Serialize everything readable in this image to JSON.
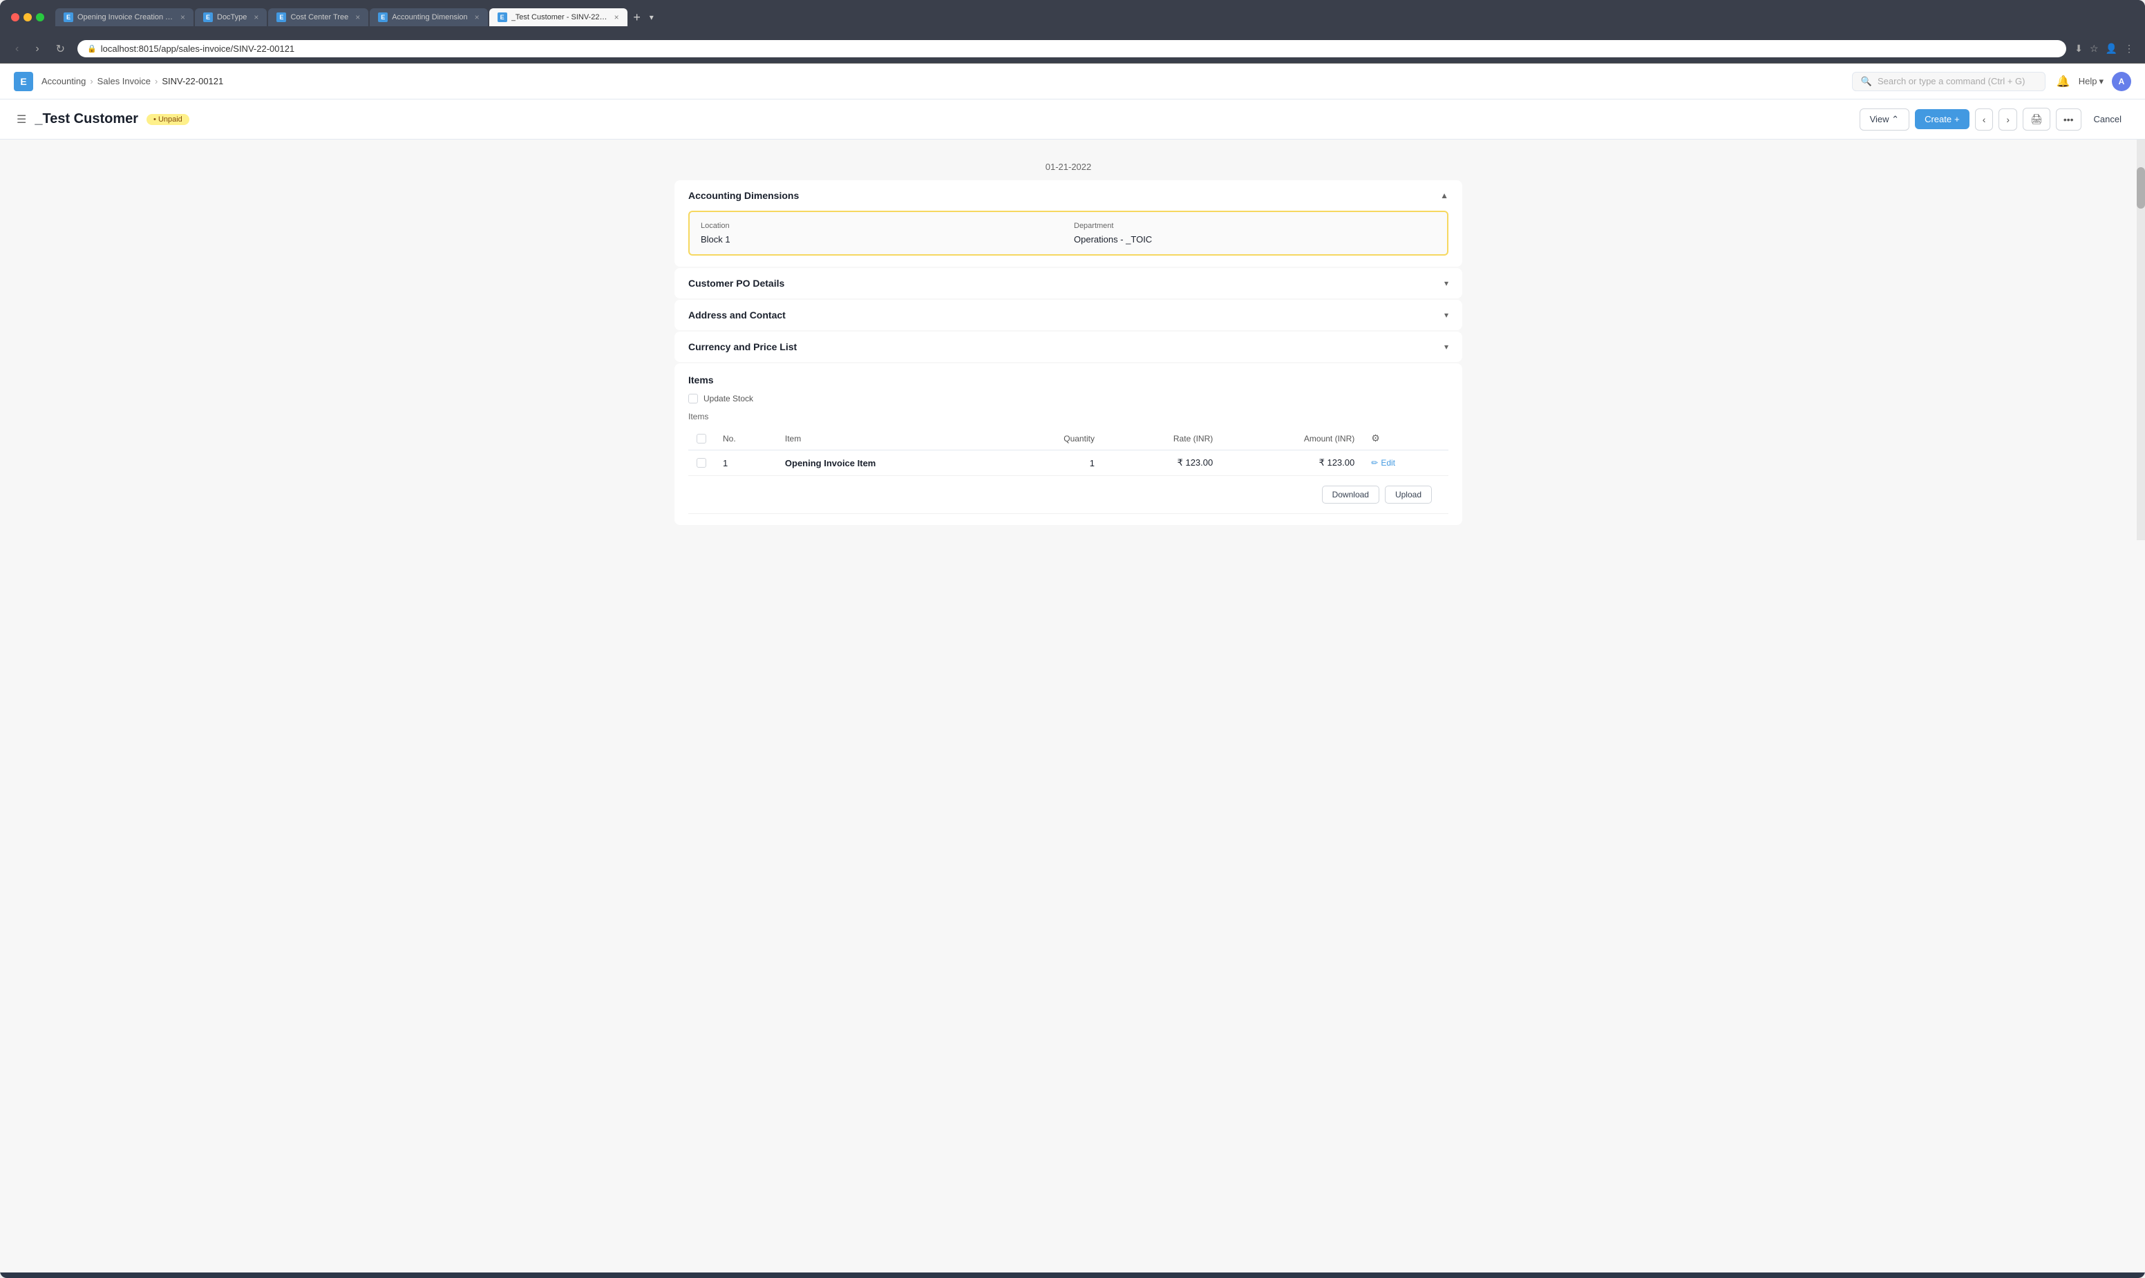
{
  "browser": {
    "url": "localhost:8015/app/sales-invoice/SINV-22-00121",
    "tabs": [
      {
        "label": "Opening Invoice Creation Tool",
        "active": false,
        "icon": "E"
      },
      {
        "label": "DocType",
        "active": false,
        "icon": "E"
      },
      {
        "label": "Cost Center Tree",
        "active": false,
        "icon": "E"
      },
      {
        "label": "Accounting Dimension",
        "active": false,
        "icon": "E"
      },
      {
        "label": "_Test Customer - SINV-22-00",
        "active": true,
        "icon": "E"
      }
    ]
  },
  "breadcrumb": {
    "items": [
      "Accounting",
      "Sales Invoice",
      "SINV-22-00121"
    ]
  },
  "search": {
    "placeholder": "Search or type a command (Ctrl + G)"
  },
  "page": {
    "title": "_Test Customer",
    "status": "Unpaid",
    "date": "01-21-2022"
  },
  "actions": {
    "view": "View",
    "create": "Create",
    "cancel": "Cancel"
  },
  "sections": {
    "accounting_dimensions": {
      "title": "Accounting Dimensions",
      "expanded": true,
      "location_label": "Location",
      "location_value": "Block 1",
      "department_label": "Department",
      "department_value": "Operations - _TOIC"
    },
    "customer_po": {
      "title": "Customer PO Details",
      "expanded": false
    },
    "address_contact": {
      "title": "Address and Contact",
      "expanded": false
    },
    "currency_price": {
      "title": "Currency and Price List",
      "expanded": false
    },
    "items": {
      "title": "Items",
      "update_stock_label": "Update Stock",
      "items_label": "Items",
      "columns": {
        "no": "No.",
        "item": "Item",
        "quantity": "Quantity",
        "rate": "Rate (INR)",
        "amount": "Amount (INR)"
      },
      "rows": [
        {
          "no": "1",
          "item": "Opening Invoice Item",
          "quantity": "1",
          "rate": "₹ 123.00",
          "amount": "₹ 123.00"
        }
      ],
      "row_actions": {
        "edit": "Edit",
        "download": "Download",
        "upload": "Upload"
      }
    }
  },
  "topnav": {
    "help": "Help",
    "avatar": "A"
  }
}
